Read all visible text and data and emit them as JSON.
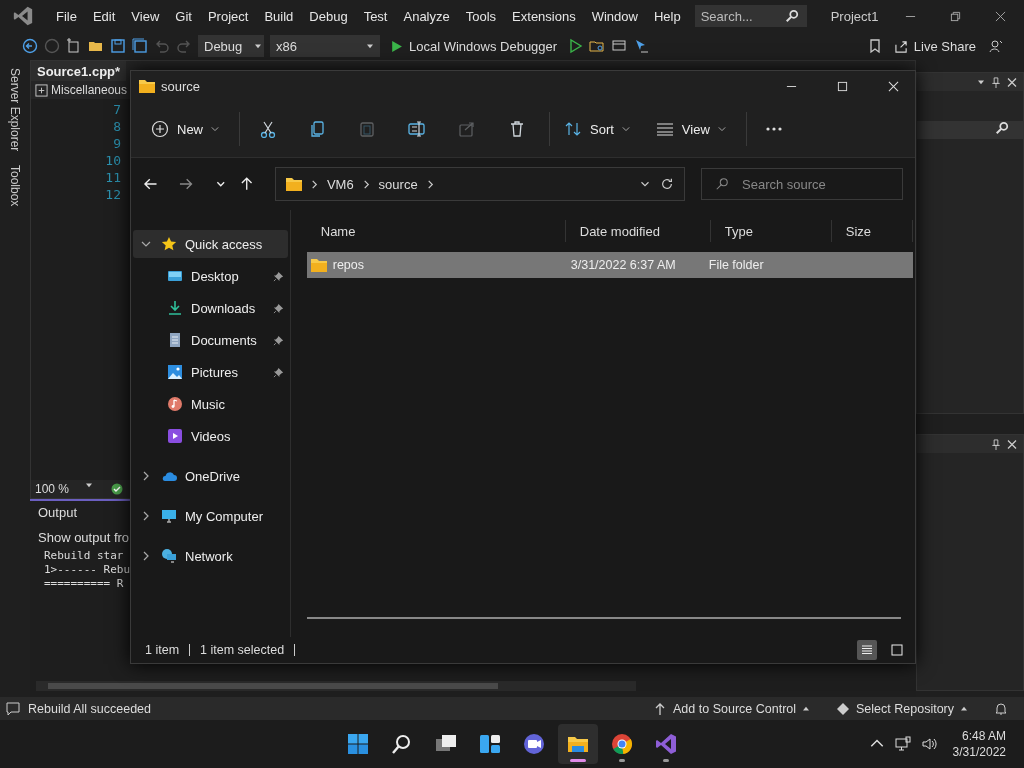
{
  "vs": {
    "menu": [
      "File",
      "Edit",
      "View",
      "Git",
      "Project",
      "Build",
      "Debug",
      "Test",
      "Analyze",
      "Tools",
      "Extensions",
      "Window",
      "Help"
    ],
    "search": {
      "placeholder": "Search..."
    },
    "project": "Project1",
    "toolbar": {
      "configuration": "Debug",
      "platform": "x86",
      "run": "Local Windows Debugger",
      "live_share": "Live Share"
    },
    "side_tabs": [
      "Server Explorer",
      "Toolbox"
    ],
    "editor": {
      "tab": "Source1.cpp*",
      "scope": "Miscellaneous",
      "line_numbers": [
        "7",
        "8",
        "9",
        "10",
        "11",
        "12"
      ],
      "zoom": "100 %"
    },
    "output": {
      "title": "Output",
      "show_from": "Show output fro",
      "lines": [
        "Rebuild star",
        "1>------ Rebu",
        "========== R"
      ]
    },
    "status_bar": {
      "message": "Rebuild All succeeded",
      "source_control": "Add to Source Control",
      "repository": "Select Repository"
    }
  },
  "explorer": {
    "title": "source",
    "commands": [
      {
        "kind": "new",
        "label": "New"
      },
      {
        "kind": "cut",
        "disabled": false
      },
      {
        "kind": "copy",
        "disabled": false
      },
      {
        "kind": "paste",
        "disabled": true
      },
      {
        "kind": "rename",
        "disabled": false
      },
      {
        "kind": "share",
        "disabled": true
      },
      {
        "kind": "delete",
        "disabled": false
      },
      {
        "kind": "sort",
        "label": "Sort"
      },
      {
        "kind": "view",
        "label": "View"
      },
      {
        "kind": "more"
      }
    ],
    "path": [
      "VM6",
      "source"
    ],
    "search": {
      "placeholder": "Search source"
    },
    "nav": [
      {
        "kind": "star",
        "label": "Quick access",
        "expanded": true,
        "selected": true,
        "children": [
          {
            "kind": "desktop",
            "label": "Desktop",
            "pinned": true
          },
          {
            "kind": "downloads",
            "label": "Downloads",
            "pinned": true
          },
          {
            "kind": "documents",
            "label": "Documents",
            "pinned": true
          },
          {
            "kind": "pictures",
            "label": "Pictures",
            "pinned": true
          },
          {
            "kind": "music",
            "label": "Music",
            "pinned": false
          },
          {
            "kind": "videos",
            "label": "Videos",
            "pinned": false
          }
        ]
      },
      {
        "kind": "cloud",
        "label": "OneDrive",
        "expanded": false,
        "selected": false
      },
      {
        "kind": "computer",
        "label": "My Computer",
        "expanded": false,
        "selected": false
      },
      {
        "kind": "network",
        "label": "Network",
        "expanded": false,
        "selected": false
      }
    ],
    "columns": [
      "Name",
      "Date modified",
      "Type",
      "Size"
    ],
    "rows": [
      {
        "name": "repos",
        "date_modified": "3/31/2022 6:37 AM",
        "type": "File folder",
        "size": "",
        "selected": true
      }
    ],
    "status": [
      "1 item",
      "1 item selected"
    ],
    "view_buttons": [
      {
        "kind": "details",
        "selected": true
      },
      {
        "kind": "tiles",
        "selected": false
      }
    ]
  },
  "taskbar": {
    "apps": [
      {
        "kind": "start",
        "active": false,
        "running": false
      },
      {
        "kind": "search",
        "active": false,
        "running": false
      },
      {
        "kind": "taskview",
        "active": false,
        "running": false
      },
      {
        "kind": "widgets",
        "active": false,
        "running": false
      },
      {
        "kind": "chat",
        "active": false,
        "running": false
      },
      {
        "kind": "folder",
        "active": true,
        "running": true
      },
      {
        "kind": "browser",
        "active": false,
        "running": true
      },
      {
        "kind": "ide",
        "active": false,
        "running": true
      }
    ],
    "time": "6:48 AM",
    "date": "3/31/2022"
  }
}
